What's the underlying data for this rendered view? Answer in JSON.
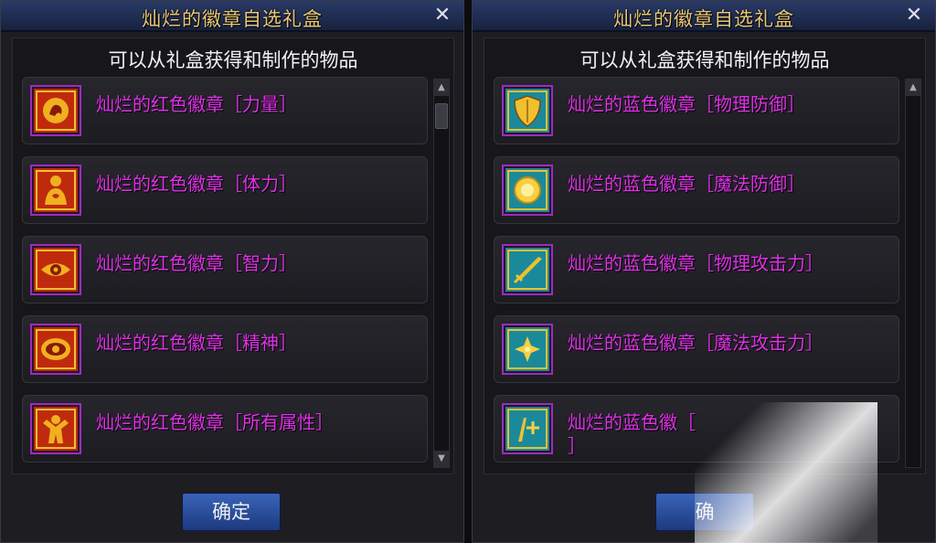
{
  "left_panel": {
    "title": "灿烂的徽章自选礼盒",
    "close": "✕",
    "subtitle": "可以从礼盒获得和制作的物品",
    "items": [
      {
        "name": "灿烂的红色徽章［力量］",
        "icon": "red-strength-badge-icon"
      },
      {
        "name": "灿烂的红色徽章［体力］",
        "icon": "red-vitality-badge-icon"
      },
      {
        "name": "灿烂的红色徽章［智力］",
        "icon": "red-intelligence-badge-icon"
      },
      {
        "name": "灿烂的红色徽章［精神］",
        "icon": "red-spirit-badge-icon"
      },
      {
        "name": "灿烂的红色徽章［所有属性］",
        "icon": "red-all-stats-badge-icon"
      }
    ],
    "confirm": "确定"
  },
  "right_panel": {
    "title": "灿烂的徽章自选礼盒",
    "close": "✕",
    "subtitle": "可以从礼盒获得和制作的物品",
    "items": [
      {
        "name": "灿烂的蓝色徽章［物理防御］",
        "icon": "blue-physical-defense-badge-icon"
      },
      {
        "name": "灿烂的蓝色徽章［魔法防御］",
        "icon": "blue-magic-defense-badge-icon"
      },
      {
        "name": "灿烂的蓝色徽章［物理攻击力］",
        "icon": "blue-physical-attack-badge-icon"
      },
      {
        "name": "灿烂的蓝色徽章［魔法攻击力］",
        "icon": "blue-magic-attack-badge-icon"
      },
      {
        "name": "灿烂的蓝色徽［",
        "name_line2": "］",
        "icon": "blue-badge-icon"
      }
    ],
    "confirm": "确"
  },
  "colors": {
    "item_name": "#e030e8",
    "title": "#e8c878",
    "red_badge": "#d03010",
    "blue_badge": "#1a8a9a",
    "gold": "#f0c030"
  }
}
